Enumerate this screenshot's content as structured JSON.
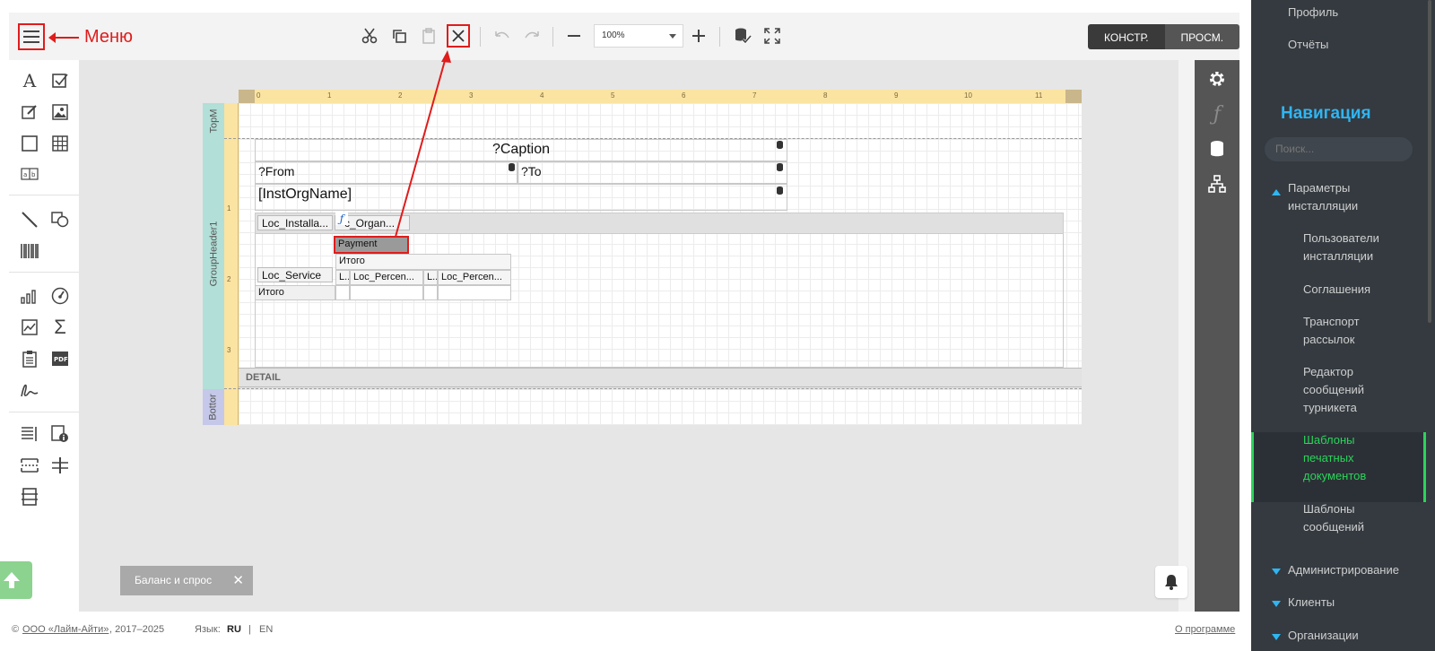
{
  "toolbar": {
    "menu_label": "Меню",
    "zoom_value": "100%",
    "mode_construct": "КОНСТР.",
    "mode_preview": "ПРОСМ."
  },
  "toolbox": {
    "text_tool": "A"
  },
  "report": {
    "ruler_numbers": [
      "0",
      "1",
      "2",
      "3",
      "4",
      "5",
      "6",
      "7",
      "8",
      "9",
      "10",
      "11"
    ],
    "vruler_numbers": [
      "1",
      "2",
      "3"
    ],
    "band_top": "TopM",
    "band_group": "GroupHeader1",
    "band_bottom": "Bottor",
    "caption": "?Caption",
    "from": "?From",
    "to": "?To",
    "inst_org_name": "[InstOrgName]",
    "pivot_chip_installa": "Loc_Installa...",
    "pivot_chip_organ": "c_Organ...",
    "payment": "Payment",
    "itogo_col": "Итого",
    "loc_service": "Loc_Service",
    "col_l1": "L...",
    "col_percen1": "Loc_Percen...",
    "col_l2": "L...",
    "col_percen2": "Loc_Percen...",
    "itogo_row": "Итого",
    "detail": "DETAIL"
  },
  "toast": {
    "text": "Баланс и спрос",
    "close": "✕"
  },
  "footer": {
    "copyright_prefix": "©",
    "company": "ООО «Лайм-Айти»",
    "years": ", 2017–2025",
    "lang_label": "Язык:",
    "lang_ru": "RU",
    "lang_sep": "|",
    "lang_en": "EN",
    "about": "О программе"
  },
  "sidebar": {
    "profile": "Профиль",
    "reports": "Отчёты",
    "nav_title": "Навигация",
    "search_placeholder": "Поиск...",
    "install_params_1": "Параметры",
    "install_params_2": "инсталляции",
    "users_1": "Пользователи",
    "users_2": "инсталляции",
    "agreements": "Соглашения",
    "transport_1": "Транспорт",
    "transport_2": "рассылок",
    "editor_1": "Редактор",
    "editor_2": "сообщений",
    "editor_3": "турникета",
    "templates_print_1": "Шаблоны",
    "templates_print_2": "печатных",
    "templates_print_3": "документов",
    "templates_msg_1": "Шаблоны",
    "templates_msg_2": "сообщений",
    "admin": "Администрирование",
    "clients": "Клиенты",
    "orgs": "Организации"
  },
  "colors": {
    "accent": "#2fb5f2",
    "active_green": "#2bd45a",
    "annotation_red": "#e01c1c"
  }
}
